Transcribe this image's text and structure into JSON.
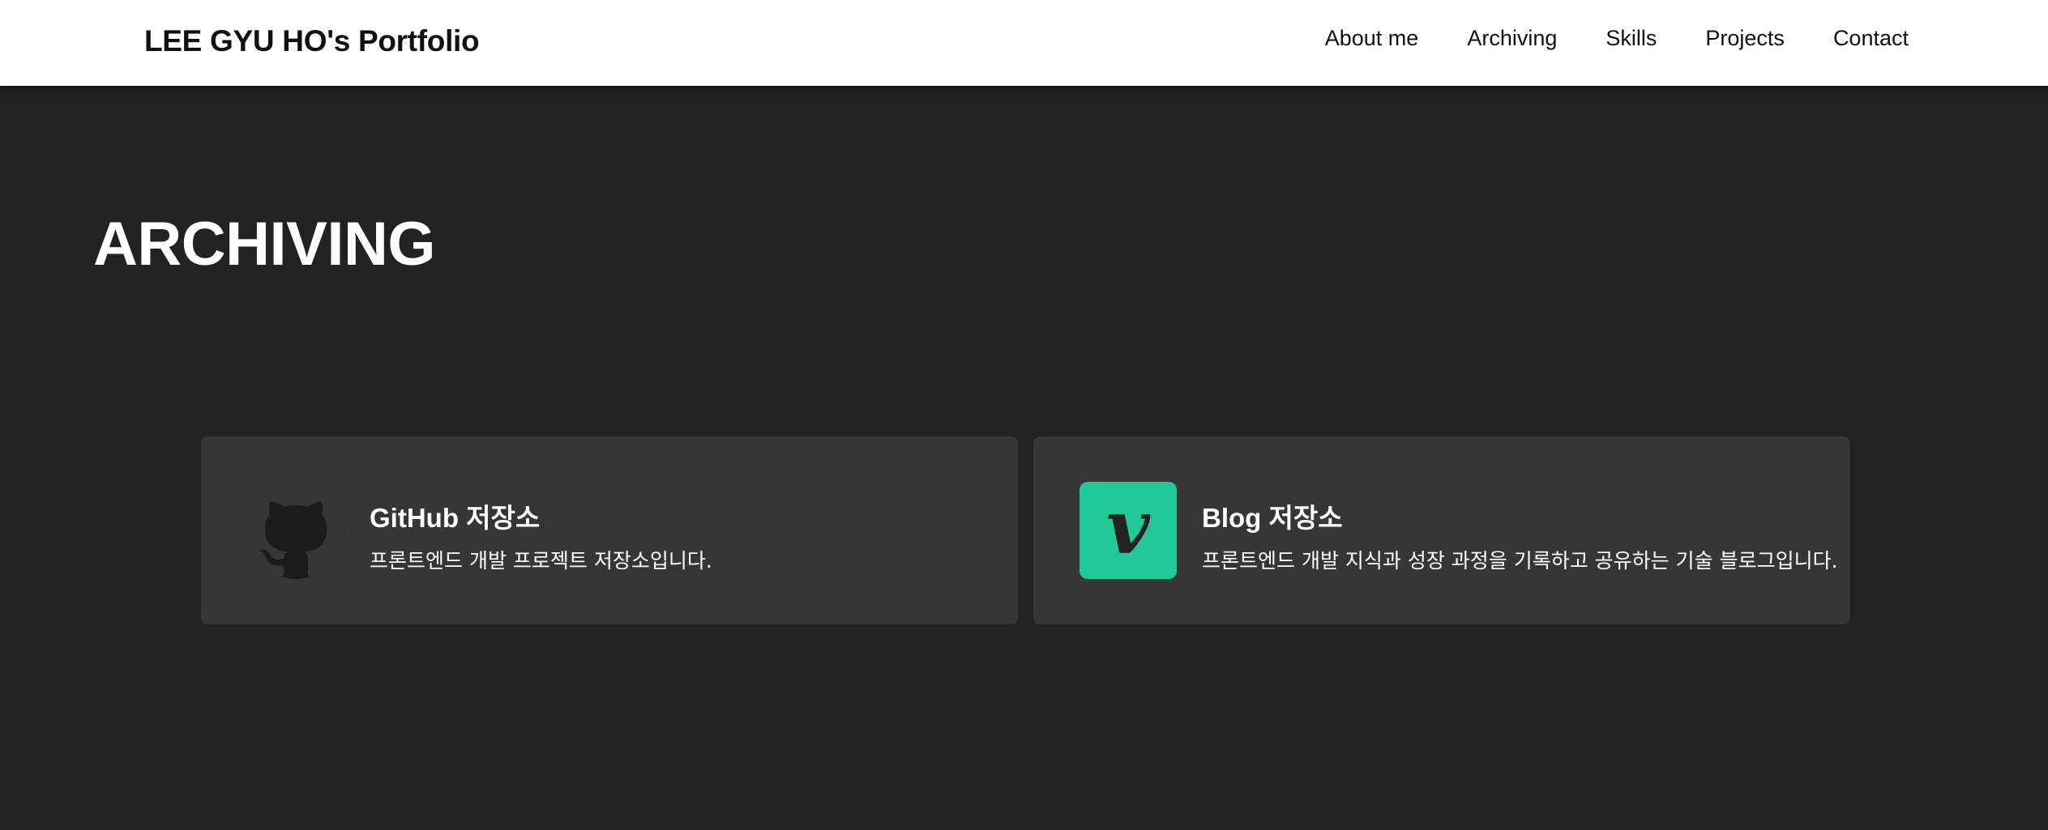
{
  "header": {
    "logo": "LEE GYU HO's Portfolio",
    "nav": [
      "About me",
      "Archiving",
      "Skills",
      "Projects",
      "Contact"
    ]
  },
  "section": {
    "title": "ARCHIVING"
  },
  "cards": [
    {
      "icon": "github-icon",
      "title": "GitHub 저장소",
      "description": "프론트엔드 개발 프로젝트 저장소입니다."
    },
    {
      "icon": "vimeo-icon",
      "icon_glyph": "v",
      "title": "Blog 저장소",
      "description": "프론트엔드 개발 지식과 성장 과정을 기록하고 공유하는 기술 블로그입니다."
    }
  ],
  "colors": {
    "background": "#222222",
    "card": "#363636",
    "header": "#ffffff",
    "accent": "#20c997"
  }
}
